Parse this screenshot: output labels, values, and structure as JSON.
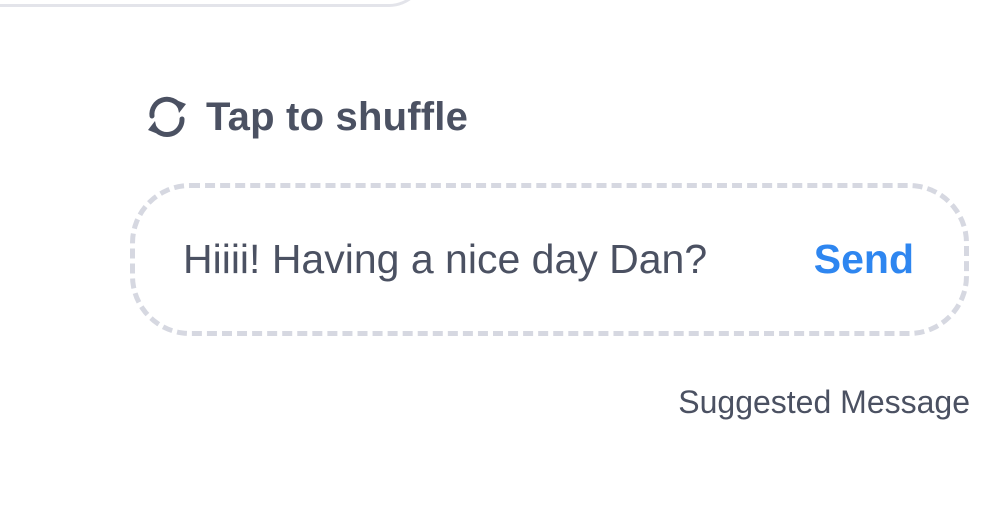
{
  "shuffle": {
    "label": "Tap to shuffle",
    "icon": "refresh-icon"
  },
  "suggestion": {
    "message": "Hiiii! Having a nice day Dan?",
    "send_label": "Send"
  },
  "caption": "Suggested Message",
  "colors": {
    "text": "#4b5162",
    "accent": "#2e86f0",
    "dashed_border": "#d6d8e1",
    "top_card_border": "#e3e4ea"
  }
}
